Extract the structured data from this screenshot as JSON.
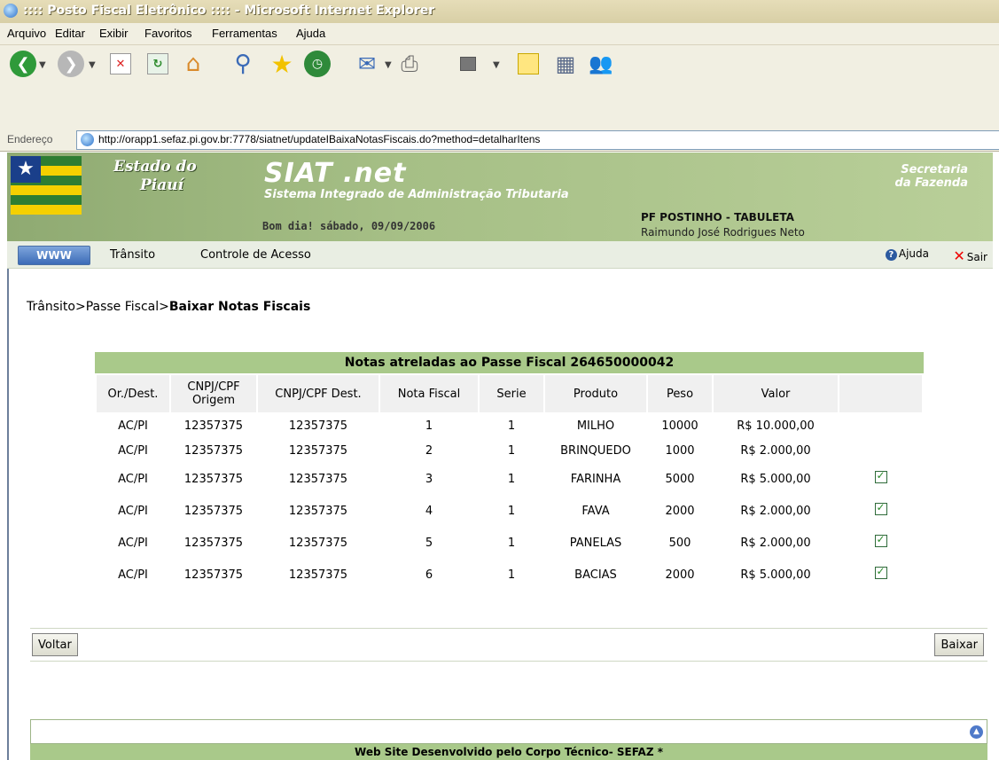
{
  "window": {
    "title": ":::: Posto Fiscal Eletrônico :::: - Microsoft Internet Explorer"
  },
  "menu": [
    "Arquivo",
    "Editar",
    "Exibir",
    "Favoritos",
    "Ferramentas",
    "Ajuda"
  ],
  "address": {
    "label": "Endereço",
    "url": "http://orapp1.sefaz.pi.gov.br:7778/siatnet/updateIBaixaNotasFiscais.do?method=detalharItens"
  },
  "header": {
    "state_line1": "Estado do",
    "state_line2": "Piauí",
    "app_name": "SIAT .net",
    "app_subtitle": "Sistema Integrado de Administração Tributaria",
    "dept_line1": "Secretaria",
    "dept_line2": "da Fazenda",
    "greeting": "Bom dia! sábado, 09/09/2006",
    "post_name": "PF POSTINHO - TABULETA",
    "user_name": "Raimundo José Rodrigues Neto"
  },
  "nav": {
    "www_label": "WWW",
    "items": [
      "Trânsito",
      "Controle de Acesso"
    ],
    "help_label": "Ajuda",
    "exit_label": "Sair"
  },
  "breadcrumb": {
    "part1": "Trânsito",
    "sep": ">",
    "part2": "Passe Fiscal",
    "current": "Baixar Notas Fiscais"
  },
  "table": {
    "caption": "Notas atreladas ao Passe Fiscal 264650000042",
    "headers": [
      "Or./Dest.",
      "CNPJ/CPF Origem",
      "CNPJ/CPF Dest.",
      "Nota Fiscal",
      "Serie",
      "Produto",
      "Peso",
      "Valor",
      ""
    ],
    "rows": [
      {
        "ordest": "AC/PI",
        "origem": "12357375",
        "dest": "12357375",
        "nota": "1",
        "serie": "1",
        "produto": "MILHO",
        "peso": "10000",
        "valor": "R$ 10.000,00",
        "checked": false
      },
      {
        "ordest": "AC/PI",
        "origem": "12357375",
        "dest": "12357375",
        "nota": "2",
        "serie": "1",
        "produto": "BRINQUEDO",
        "peso": "1000",
        "valor": "R$ 2.000,00",
        "checked": false
      },
      {
        "ordest": "AC/PI",
        "origem": "12357375",
        "dest": "12357375",
        "nota": "3",
        "serie": "1",
        "produto": "FARINHA",
        "peso": "5000",
        "valor": "R$ 5.000,00",
        "checked": true
      },
      {
        "ordest": "AC/PI",
        "origem": "12357375",
        "dest": "12357375",
        "nota": "4",
        "serie": "1",
        "produto": "FAVA",
        "peso": "2000",
        "valor": "R$ 2.000,00",
        "checked": true
      },
      {
        "ordest": "AC/PI",
        "origem": "12357375",
        "dest": "12357375",
        "nota": "5",
        "serie": "1",
        "produto": "PANELAS",
        "peso": "500",
        "valor": "R$ 2.000,00",
        "checked": true
      },
      {
        "ordest": "AC/PI",
        "origem": "12357375",
        "dest": "12357375",
        "nota": "6",
        "serie": "1",
        "produto": "BACIAS",
        "peso": "2000",
        "valor": "R$ 5.000,00",
        "checked": true
      }
    ]
  },
  "actions": {
    "back_label": "Voltar",
    "submit_label": "Baixar"
  },
  "footer": {
    "text": "Web Site Desenvolvido pelo Corpo Técnico- SEFAZ *"
  },
  "colors": {
    "header_green": "#a6bf86",
    "caption_green": "#a9c98a",
    "nav_bg": "#e9eee3",
    "exit_red": "#ee0000"
  }
}
